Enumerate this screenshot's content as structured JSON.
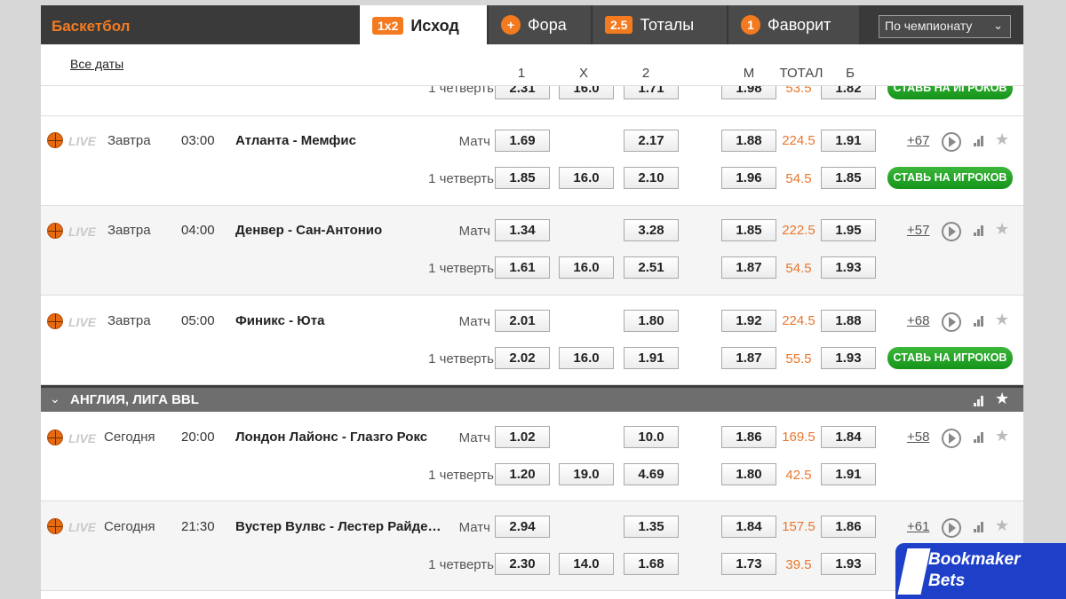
{
  "header": {
    "sport": "Баскетбол",
    "tabs": [
      {
        "badge": "1x2",
        "label": "Исход"
      },
      {
        "badge": "+",
        "label": "Фора"
      },
      {
        "badge": "2.5",
        "label": "Тоталы"
      },
      {
        "badge": "1",
        "label": "Фаворит"
      }
    ],
    "sort_select": "По чемпионату"
  },
  "columns": {
    "all_dates": "Все даты",
    "c1": "1",
    "cx": "X",
    "c2": "2",
    "m": "М",
    "total": "ТОТАЛ",
    "b": "Б"
  },
  "partial_row": {
    "period": "1 четверть",
    "o1": "2.31",
    "ox": "16.0",
    "o2": "1.71",
    "m": "1.98",
    "total": "53.5",
    "b": "1.82",
    "promo": "СТАВЬ НА ИГРОКОВ"
  },
  "live_label": "LIVE",
  "matches": [
    {
      "day": "Завтра",
      "time": "03:00",
      "teams": "Атланта - Мемфис",
      "match_label": "Матч",
      "o1": "1.69",
      "o2": "2.17",
      "m": "1.88",
      "total": "224.5",
      "b": "1.91",
      "more": "+67",
      "q_label": "1 четверть",
      "q1": "1.85",
      "qx": "16.0",
      "q2": "2.10",
      "qm": "1.96",
      "qtotal": "54.5",
      "qb": "1.85",
      "promo": "СТАВЬ НА ИГРОКОВ"
    },
    {
      "day": "Завтра",
      "time": "04:00",
      "teams": "Денвер - Сан-Антонио",
      "match_label": "Матч",
      "o1": "1.34",
      "o2": "3.28",
      "m": "1.85",
      "total": "222.5",
      "b": "1.95",
      "more": "+57",
      "q_label": "1 четверть",
      "q1": "1.61",
      "qx": "16.0",
      "q2": "2.51",
      "qm": "1.87",
      "qtotal": "54.5",
      "qb": "1.93"
    },
    {
      "day": "Завтра",
      "time": "05:00",
      "teams": "Финикс - Юта",
      "match_label": "Матч",
      "o1": "2.01",
      "o2": "1.80",
      "m": "1.92",
      "total": "224.5",
      "b": "1.88",
      "more": "+68",
      "q_label": "1 четверть",
      "q1": "2.02",
      "qx": "16.0",
      "q2": "1.91",
      "qm": "1.87",
      "qtotal": "55.5",
      "qb": "1.93",
      "promo": "СТАВЬ НА ИГРОКОВ"
    },
    {
      "day": "Сегодня",
      "time": "20:00",
      "teams": "Лондон Лайонс - Глазго Рокс",
      "match_label": "Матч",
      "o1": "1.02",
      "o2": "10.0",
      "m": "1.86",
      "total": "169.5",
      "b": "1.84",
      "more": "+58",
      "q_label": "1 четверть",
      "q1": "1.20",
      "qx": "19.0",
      "q2": "4.69",
      "qm": "1.80",
      "qtotal": "42.5",
      "qb": "1.91"
    },
    {
      "day": "Сегодня",
      "time": "21:30",
      "teams": "Вустер Вулвс - Лестер Райде…",
      "match_label": "Матч",
      "o1": "2.94",
      "o2": "1.35",
      "m": "1.84",
      "total": "157.5",
      "b": "1.86",
      "more": "+61",
      "q_label": "1 четверть",
      "q1": "2.30",
      "qx": "14.0",
      "q2": "1.68",
      "qm": "1.73",
      "qtotal": "39.5",
      "qb": "1.93"
    }
  ],
  "league": {
    "name": "АНГЛИЯ, ЛИГА BBL"
  },
  "watermark": {
    "line1": "Bookmaker",
    "line2": "Bets"
  },
  "colors": {
    "accent": "#f47a20",
    "promo_green": "#1fa422",
    "total_orange": "#e8772e"
  },
  "icons": [
    "basketball-icon",
    "play-icon",
    "stats-icon",
    "star-icon",
    "chevron-down-icon"
  ]
}
